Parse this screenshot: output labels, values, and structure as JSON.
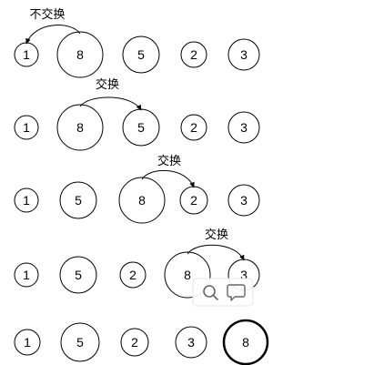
{
  "diagram": {
    "rows": [
      {
        "values": [
          "1",
          "8",
          "5",
          "2",
          "3"
        ],
        "arrow": {
          "label": "不交换",
          "from": 1,
          "to": 0
        }
      },
      {
        "values": [
          "1",
          "8",
          "5",
          "2",
          "3"
        ],
        "arrow": {
          "label": "交换",
          "from": 1,
          "to": 2
        }
      },
      {
        "values": [
          "1",
          "5",
          "8",
          "2",
          "3"
        ],
        "arrow": {
          "label": "交换",
          "from": 2,
          "to": 3
        }
      },
      {
        "values": [
          "1",
          "5",
          "2",
          "8",
          "3"
        ],
        "arrow": {
          "label": "交换",
          "from": 3,
          "to": 4
        }
      },
      {
        "values": [
          "1",
          "5",
          "2",
          "3",
          "8"
        ],
        "highlight_index": 4
      }
    ],
    "overlay": {
      "icons": [
        "search-icon",
        "comment-icon"
      ]
    }
  }
}
